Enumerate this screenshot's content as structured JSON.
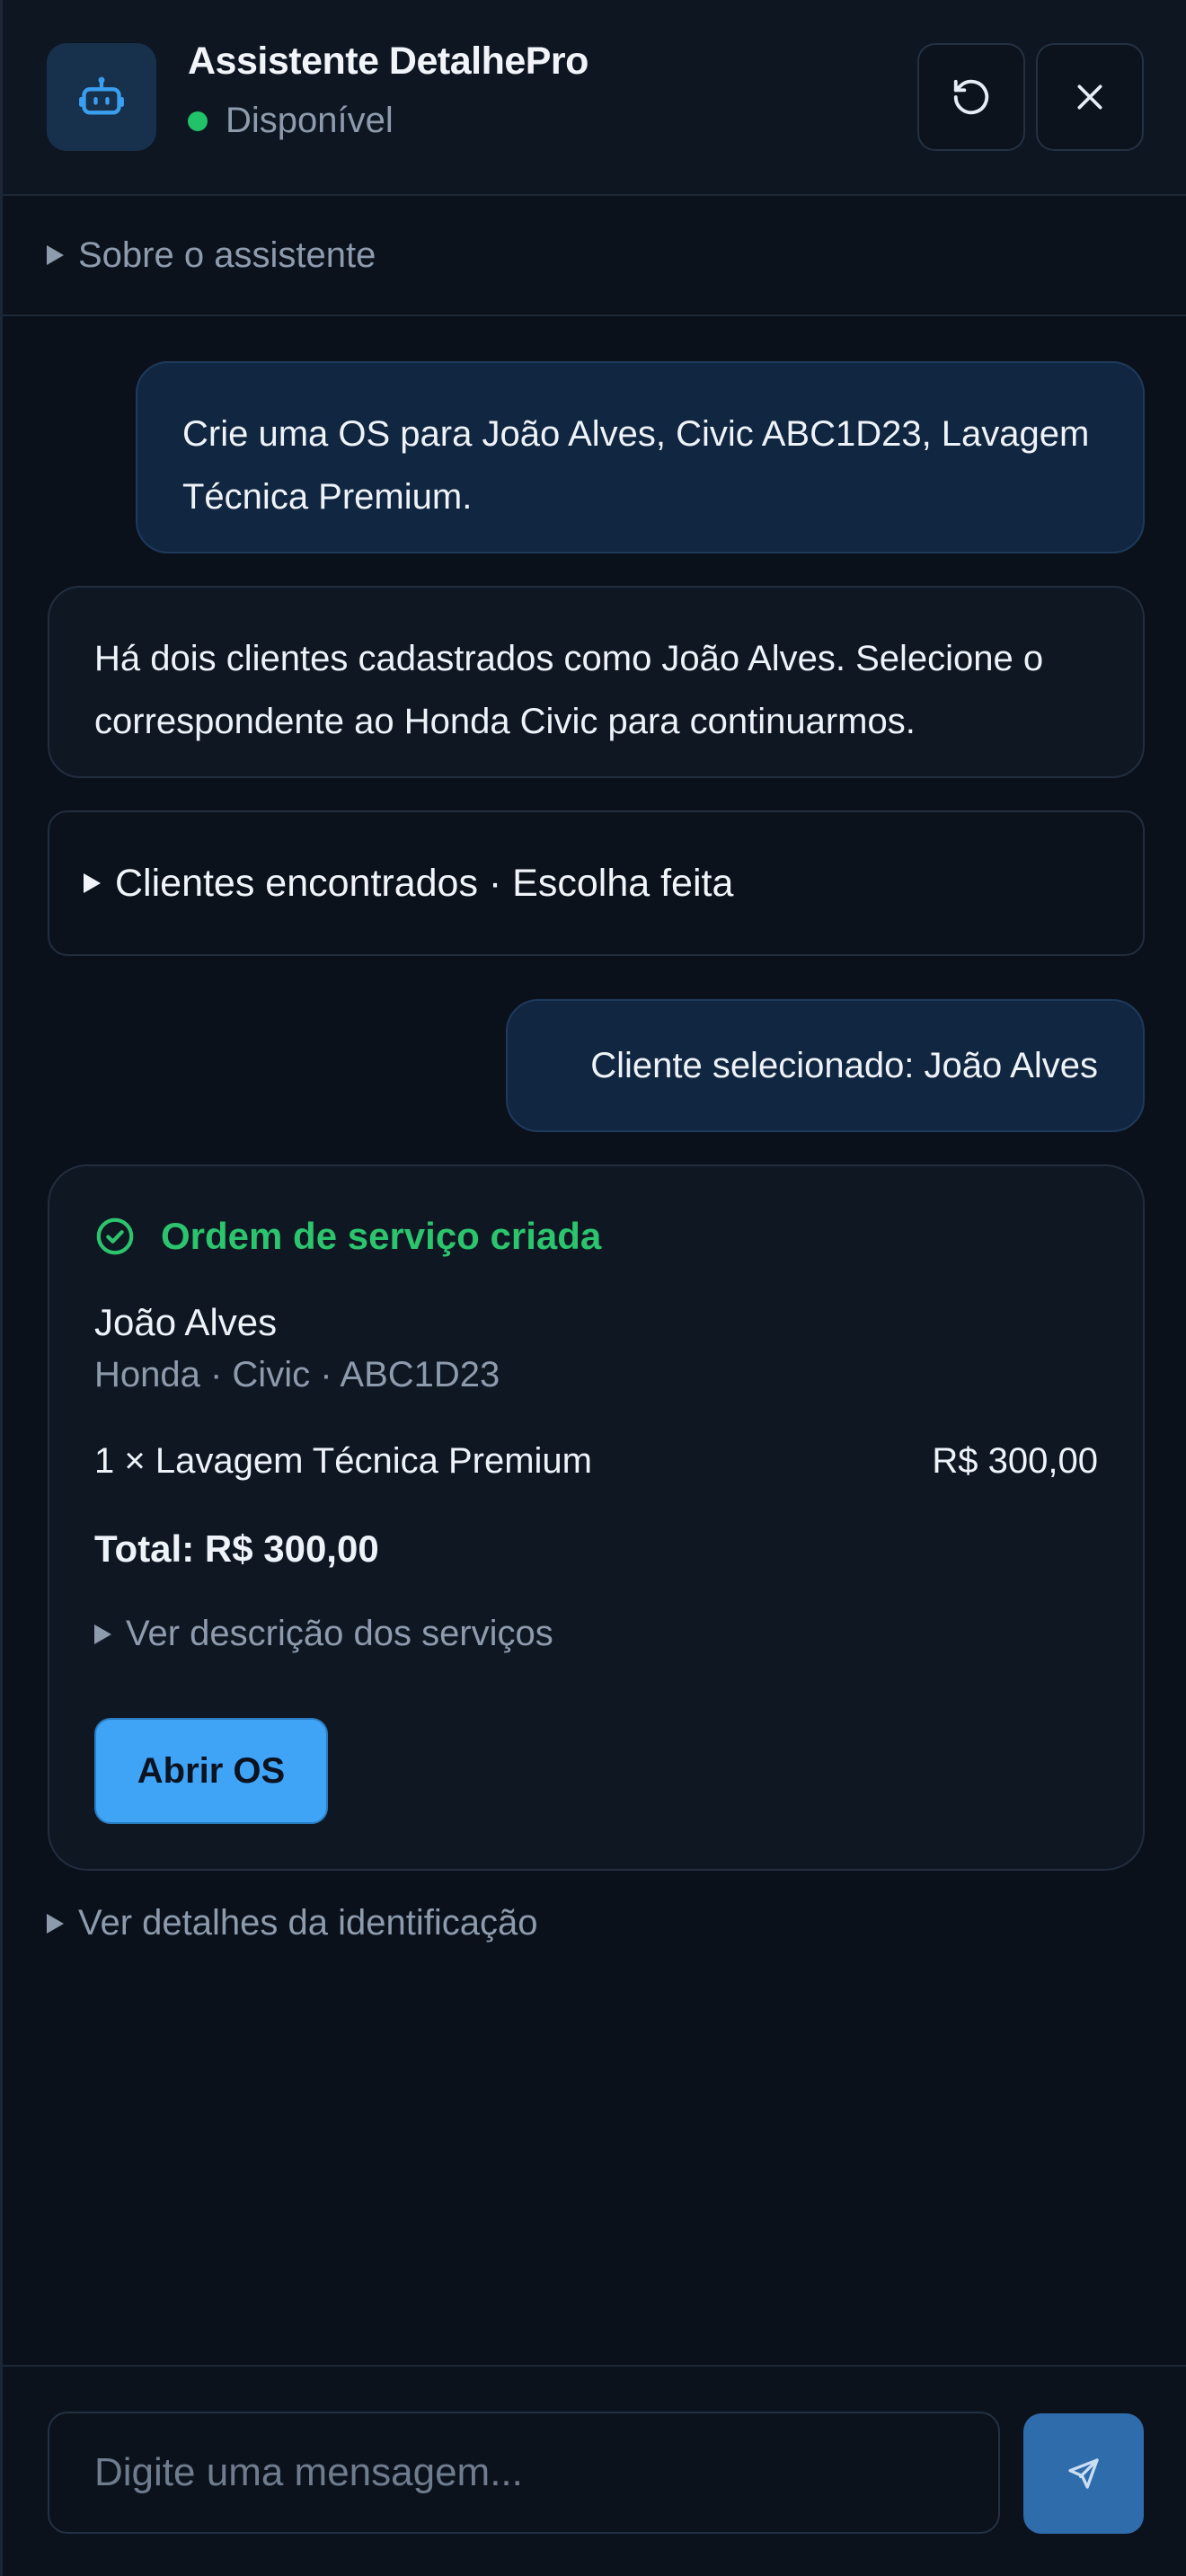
{
  "header": {
    "title": "Assistente DetalhePro",
    "status": "Disponível"
  },
  "about": {
    "label": "Sobre o assistente"
  },
  "messages": {
    "user_1": "Crie uma OS para João Alves, Civic ABC1D23, Lavagem Técnica Premium.",
    "bot_1": "Há dois clientes cadastrados como João Alves. Selecione o correspondente ao Honda Civic para continuarmos.",
    "clients_found": "Clientes encontrados · Escolha feita",
    "user_2": "Cliente selecionado: João Alves"
  },
  "order": {
    "title": "Ordem de serviço criada",
    "client": "João Alves",
    "vehicle": "Honda · Civic · ABC1D23",
    "item": "1 × Lavagem Técnica Premium",
    "item_price": "R$ 300,00",
    "total": "Total: R$ 300,00",
    "description_toggle": "Ver descrição dos serviços",
    "open_button": "Abrir OS",
    "success_color": "#2cc46d"
  },
  "identification_toggle": "Ver detalhes da identificação",
  "composer": {
    "placeholder": "Digite uma mensagem..."
  },
  "colors": {
    "accent": "#3fa4f6",
    "status_online": "#22c269",
    "background": "#0a111b"
  },
  "icons": {
    "avatar": "robot-icon",
    "reset": "reset-icon",
    "close": "close-icon",
    "success": "check-circle-icon",
    "send": "send-icon"
  }
}
